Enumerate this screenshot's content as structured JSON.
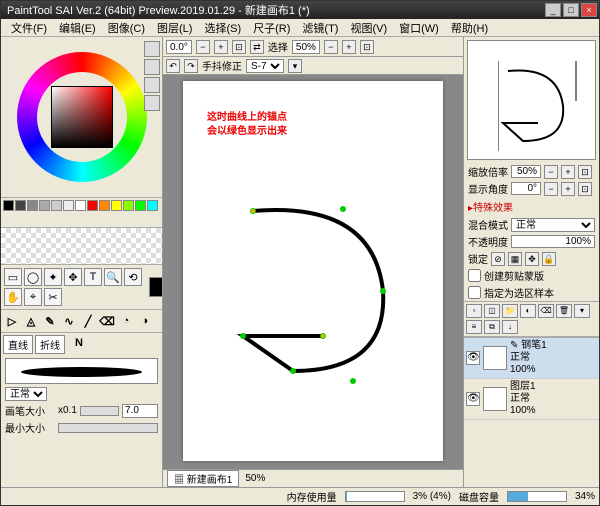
{
  "title": "PaintTool SAI Ver.2 (64bit) Preview.2019.01.29 - 新建画布1 (*)",
  "menu": [
    "文件(F)",
    "编辑(E)",
    "图像(C)",
    "图层(L)",
    "选择(S)",
    "尺子(R)",
    "滤镜(T)",
    "视图(V)",
    "窗口(W)",
    "帮助(H)"
  ],
  "canvas_toolbar": {
    "rot": "0.0°",
    "select_label": "选择",
    "select_pct": "50%"
  },
  "canvas_sub": {
    "hand_label": "手抖修正",
    "hand_val": "S-7"
  },
  "annotation": {
    "l1": "这时曲线上的锚点",
    "l2": "会以绿色显示出来"
  },
  "doc_tab": "新建画布1",
  "doc_zoom": "50%",
  "nav": {
    "zoom_label": "缩放倍率",
    "zoom_val": "50%",
    "angle_label": "显示角度",
    "angle_val": "0°"
  },
  "fx_head": "▸特殊效果",
  "blend": {
    "label": "混合模式",
    "val": "正常"
  },
  "opacity": {
    "label": "不透明度",
    "val": "100%"
  },
  "lock": {
    "label": "锁定"
  },
  "clip": {
    "label": "创建剪贴蒙版"
  },
  "regionsample": {
    "label": "指定为选区样本"
  },
  "layers": [
    {
      "name": "钢笔1",
      "mode": "正常",
      "pct": "100%"
    },
    {
      "name": "图层1",
      "mode": "正常",
      "pct": "100%"
    }
  ],
  "brush_mode": "正常",
  "brush_size": {
    "label": "画笔大小",
    "mult": "x0.1",
    "val": "7.0"
  },
  "min_size": {
    "label": "最小大小"
  },
  "line_tabs": [
    "直线",
    "折线"
  ],
  "status": {
    "mem_label": "内存使用量",
    "mem_txt": "3% (4%)",
    "mem_fill": 3,
    "disk_label": "磁盘容量",
    "disk_txt": "34%",
    "disk_fill": 34
  },
  "swatches": [
    "#000",
    "#444",
    "#888",
    "#aaa",
    "#ccc",
    "#eee",
    "#fff",
    "#f00",
    "#f80",
    "#ff0",
    "#8f0",
    "#0f0",
    "#0ff"
  ]
}
